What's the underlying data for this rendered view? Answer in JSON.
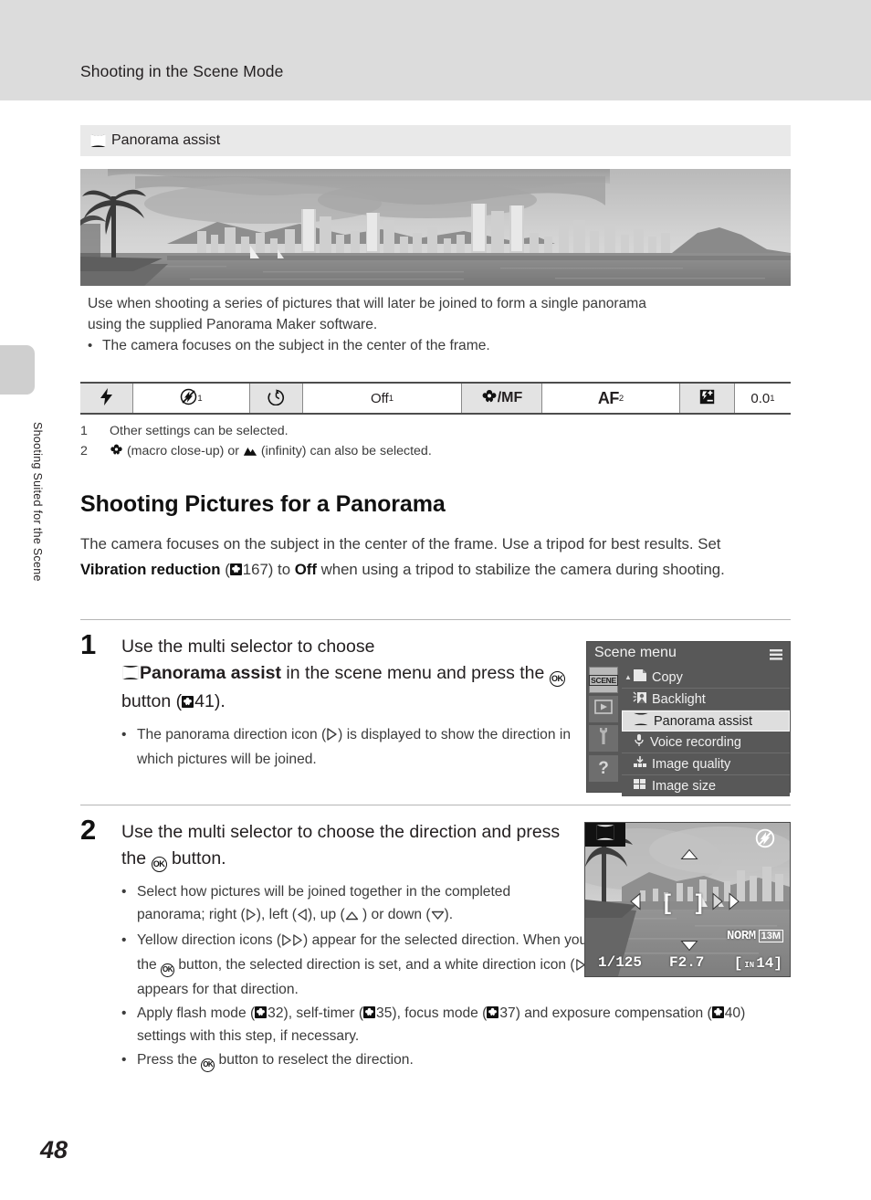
{
  "header": {
    "running_title": "Shooting in the Scene Mode"
  },
  "sidebar": {
    "running_text": "Shooting Suited for the Scene"
  },
  "page": {
    "number": "48"
  },
  "scene_callout": {
    "icon": "panorama-assist-icon",
    "title": "Panorama assist",
    "photo_alt": "Grayscale panorama photograph of a city skyline across a bay with palm trees at left and a volcanic headland at right",
    "description_lines": [
      "Use when shooting a series of pictures that will later be joined to form a single panorama",
      "using the supplied Panorama Maker software."
    ],
    "bullets": [
      "The camera focuses on the subject in the center of the frame."
    ]
  },
  "settings_table": {
    "cells": [
      {
        "name": "flash-mode-icon",
        "type": "icon",
        "icon": "flash-bolt",
        "label": ""
      },
      {
        "name": "flash-mode-value",
        "type": "value",
        "label": "",
        "icon": "flash-off",
        "sup": "1"
      },
      {
        "name": "self-timer-icon",
        "type": "icon",
        "icon": "self-timer",
        "label": ""
      },
      {
        "name": "self-timer-value",
        "type": "value",
        "label": "Off",
        "sup": "1"
      },
      {
        "name": "focus-mode-icon",
        "type": "icon",
        "icon": "macro-mf",
        "label": "/MF"
      },
      {
        "name": "focus-mode-value",
        "type": "value",
        "label": "AF",
        "sup": "2"
      },
      {
        "name": "exposure-comp-icon",
        "type": "icon",
        "icon": "exposure-comp",
        "label": ""
      },
      {
        "name": "exposure-comp-value",
        "type": "value",
        "label": "0.0",
        "sup": "1"
      }
    ],
    "footnotes": [
      {
        "num": "1",
        "text": "Other settings can be selected."
      },
      {
        "num": "2",
        "text": "(macro close-up) or (infinity) can also be selected.",
        "pre_icon": "macro-flower-icon",
        "mid_icon": "infinity-mountain-icon",
        "part1": "(macro close-up) or",
        "part2": "(infinity) can also be selected."
      }
    ]
  },
  "section": {
    "heading": "Shooting Pictures for a Panorama",
    "intro_a": "The camera focuses on the subject in the center of the frame. Use a tripod for best results. Set ",
    "intro_bold1": "Vibration reduction",
    "intro_b": " (",
    "intro_ref": "167",
    "intro_c": ") to ",
    "intro_bold2": "Off",
    "intro_d": " when using a tripod to stabilize the camera during shooting."
  },
  "steps": [
    {
      "number": "1",
      "lead_a": "Use the multi selector to choose",
      "lead_icon": "panorama-assist-icon",
      "lead_bold": "Panorama assist",
      "lead_b": " in the scene menu and press the ",
      "lead_ok": "OK",
      "lead_c": " button (",
      "lead_ref": "41",
      "lead_d": ").",
      "bullets": [
        {
          "a": "The panorama direction icon (",
          "icon": "direction-right-outline-icon",
          "b": ") is displayed to show the direction in which pictures will be joined."
        }
      ]
    },
    {
      "number": "2",
      "lead_a": "Use the multi selector to choose the direction and press the ",
      "lead_ok": "OK",
      "lead_c": " button.",
      "bullets": [
        {
          "a": "Select how pictures will be joined together in the completed panorama; right (",
          "b": "), left (",
          "c": "), up (",
          "d": " ) or down (",
          "e": ")."
        },
        {
          "a": "Yellow direction icons (",
          "b": ") appear for the selected direction. When you press the ",
          "c": " button, the selected direction is set, and a white direction icon (",
          "d": ") appears for that direction."
        },
        {
          "a": "Apply flash mode (",
          "r1": "32",
          "b": "), self-timer (",
          "r2": "35",
          "c": "), focus mode (",
          "r3": "37",
          "d": ") and exposure compensation (",
          "r4": "40",
          "e": ") settings with this step, if necessary."
        },
        {
          "a": "Press the ",
          "b": " button to reselect the direction."
        }
      ]
    }
  ],
  "scene_menu_screen": {
    "title": "Scene menu",
    "menu-icon": "hamburger-icon",
    "tabs": [
      {
        "name": "tab-scene",
        "label": "SCENE",
        "active": true
      },
      {
        "name": "tab-playback",
        "label": "",
        "icon": "play-icon",
        "active": false
      },
      {
        "name": "tab-setup",
        "label": "",
        "icon": "wrench-icon",
        "active": false
      },
      {
        "name": "tab-help",
        "label": "?",
        "icon": "question-icon",
        "active": false
      }
    ],
    "items": [
      {
        "label": "Copy",
        "icon": "copy-icon",
        "selected": false
      },
      {
        "label": "Backlight",
        "icon": "backlight-icon",
        "selected": false
      },
      {
        "label": "Panorama assist",
        "icon": "panorama-assist-icon",
        "selected": true
      },
      {
        "label": "Voice recording",
        "icon": "microphone-icon",
        "selected": false
      },
      {
        "label": "Image quality",
        "icon": "image-quality-icon",
        "selected": false
      },
      {
        "label": "Image size",
        "icon": "image-size-icon",
        "selected": false
      }
    ]
  },
  "lcd_screen": {
    "mode_icon": "panorama-assist-icon",
    "flash_icon": "flash-off-icon",
    "shutter_speed": "1/125",
    "aperture": "F2.7",
    "quality": "NORM",
    "image_size": "13M",
    "memory_icon": "IN",
    "shots_remaining": "14",
    "direction_indicators": [
      "up",
      "left",
      "right-selected",
      "right",
      "down"
    ]
  },
  "colors": {
    "header_band": "#dcdcdc",
    "callout_bar": "#e9e9e9",
    "edge_tab": "#cfcfcf",
    "body_text": "#3b3b3b",
    "heading_text": "#111111",
    "menu_bg": "#5a5a5a",
    "menu_selected": "#d8d8d8",
    "rule": "#b5b5b5"
  }
}
